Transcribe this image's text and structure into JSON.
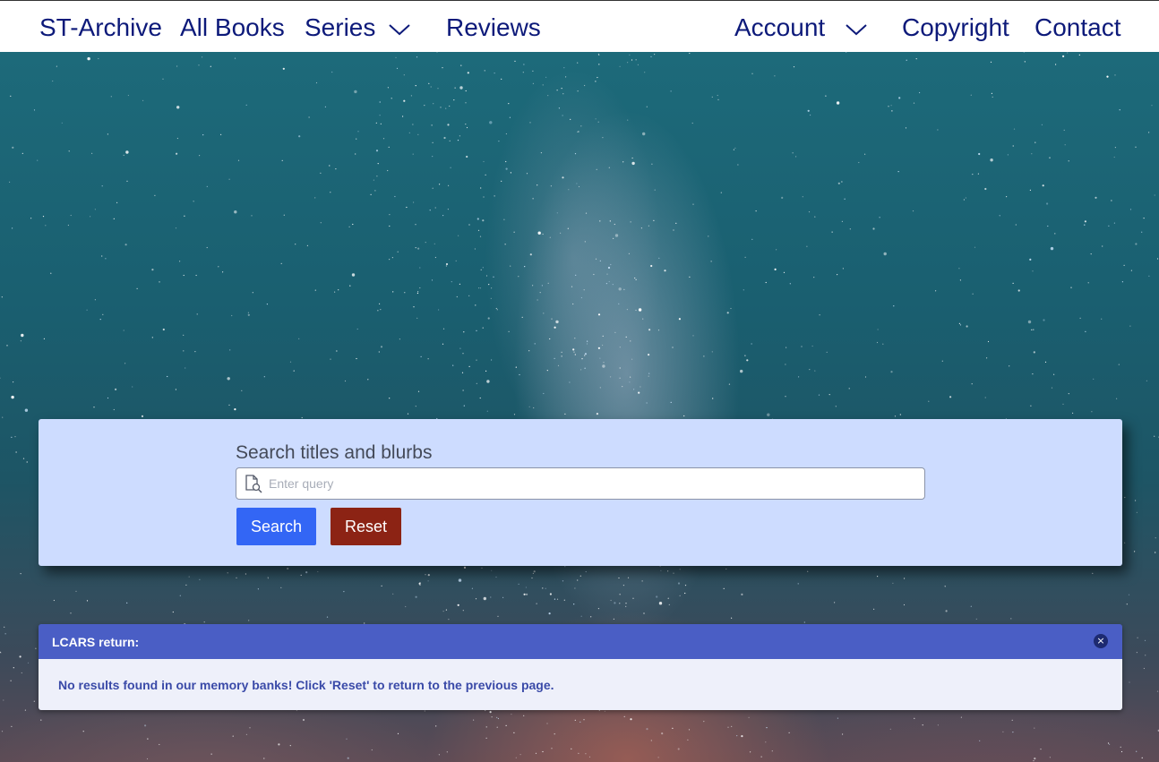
{
  "navbar": {
    "left_items": [
      {
        "label": "ST-Archive"
      },
      {
        "label": "All Books"
      },
      {
        "label": "Series"
      },
      {
        "label": "Reviews"
      }
    ],
    "right_items": [
      {
        "label": "Account"
      },
      {
        "label": "Copyright"
      },
      {
        "label": "Contact"
      }
    ]
  },
  "search": {
    "label": "Search titles and blurbs",
    "placeholder": "Enter query",
    "value": "",
    "search_button": "Search",
    "reset_button": "Reset"
  },
  "alert": {
    "title": "LCARS return:",
    "close_symbol": "×",
    "message": "No results found in our memory banks! Click 'Reset' to return to the previous page."
  },
  "colors": {
    "nav_text": "#0d1a7a",
    "panel_bg": "#cddcff",
    "search_button": "#3366f5",
    "reset_button": "#8c2314",
    "alert_header": "#4a5ec5",
    "alert_body": "#eef0fa",
    "alert_text": "#3a4aa8"
  }
}
